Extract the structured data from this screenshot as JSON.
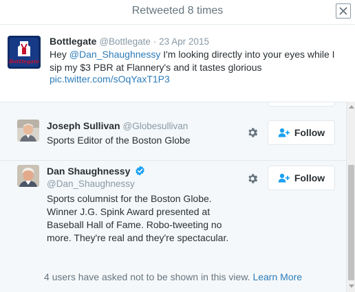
{
  "modal": {
    "title": "Retweeted 8 times",
    "close_icon": "close-icon"
  },
  "tweet": {
    "name": "Bottlegate",
    "handle": "@Bottlegate",
    "separator": "·",
    "date": "23 Apr 2015",
    "text_prefix": "Hey ",
    "mention": "@Dan_Shaughnessy",
    "text_suffix": " I'm looking directly into your eyes while I sip my $3 PBR at Flannery's and it tastes glorious",
    "link": "pic.twitter.com/sOqYaxT1P3",
    "avatar_logo_text": "Bottlegate"
  },
  "users": [
    {
      "name": "Joseph Sullivan",
      "handle": "@Globesullivan",
      "bio": "Sports Editor of the Boston Globe",
      "verified": false,
      "follow_label": "Follow"
    },
    {
      "name": "Dan Shaughnessy",
      "handle": "@Dan_Shaughnessy",
      "bio": "Sports columnist for the Boston Globe. Winner J.G. Spink Award presented at Baseball Hall of Fame. Robo-tweeting no more. They're real and they're spectacular.",
      "verified": true,
      "follow_label": "Follow"
    }
  ],
  "footer": {
    "note": "4 users have asked not to be shown in this view.",
    "learn_more": "Learn More"
  },
  "colors": {
    "link": "#2b7bb9",
    "verified": "#1da1f2",
    "muted": "#8899a6",
    "panel_bg": "#f5f8fa"
  }
}
